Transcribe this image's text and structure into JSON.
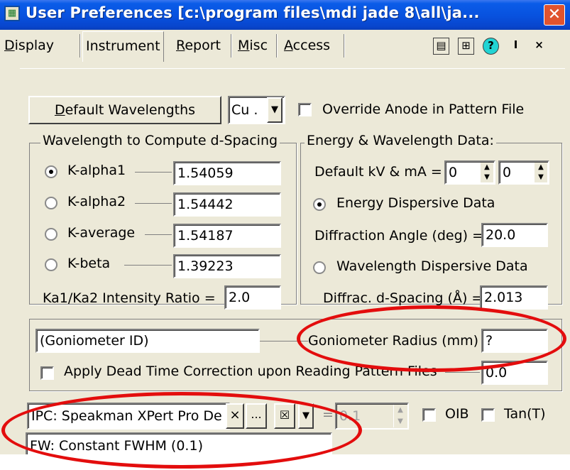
{
  "window": {
    "title": "User Preferences [c:\\program files\\mdi jade 8\\all\\ja...",
    "close_glyph": "✕",
    "icon_name": "app-icon"
  },
  "tabs": [
    {
      "label": "Display",
      "selected": false
    },
    {
      "label": "Instrument",
      "selected": true
    },
    {
      "label": "Report",
      "selected": false
    },
    {
      "label": "Misc",
      "selected": false
    },
    {
      "label": "Access",
      "selected": false
    }
  ],
  "toolbar": {
    "icons": [
      "layout-icon",
      "grid-icon",
      "help-icon",
      "pin-icon",
      "close-icon"
    ],
    "grid_glyph": "⊞",
    "help_glyph": "?",
    "pin_glyph": "I",
    "close_glyph": "×"
  },
  "top": {
    "default_wavelengths_label": "Default Wavelengths",
    "anode_value": "Cu .",
    "override_label": "Override Anode in Pattern File",
    "override_checked": false
  },
  "wavelength_group": {
    "title": "Wavelength to Compute d-Spacing",
    "options": [
      {
        "label": "K-alpha1",
        "value": "1.54059",
        "selected": true
      },
      {
        "label": "K-alpha2",
        "value": "1.54442",
        "selected": false
      },
      {
        "label": "K-average",
        "value": "1.54187",
        "selected": false
      },
      {
        "label": "K-beta",
        "value": "1.39223",
        "selected": false
      }
    ],
    "ratio_label": "Ka1/Ka2 Intensity Ratio =",
    "ratio_value": "2.0"
  },
  "energy_group": {
    "title": "Energy & Wavelength Data:",
    "kv_ma_label": "Default kV & mA =",
    "kv_value": "0",
    "ma_value": "0",
    "energy_label": "Energy Dispersive Data",
    "energy_selected": true,
    "angle_label": "Diffraction Angle (deg) =",
    "angle_value": "20.0",
    "wavelength_label": "Wavelength Dispersive Data",
    "wavelength_selected": false,
    "dspacing_label": "Diffrac. d-Spacing (Å) =",
    "dspacing_value": "2.013"
  },
  "goniometer": {
    "id_value": "(Goniometer ID)",
    "radius_label": "Goniometer Radius (mm) =",
    "radius_value": "?",
    "deadtime_label": "Apply Dead Time Correction upon Reading Pattern Files",
    "deadtime_checked": false,
    "deadtime_value": "0.0"
  },
  "ipc": {
    "combo_value": "IPC: Speakman XPert Pro De",
    "clear_glyph": "×",
    "browse_glyph": "...",
    "eq_label": "=",
    "spin_value": "0.1",
    "oib_label": "OIB",
    "tan_label": "Tan(T)",
    "fw_value": "FW: Constant FWHM (0.1)"
  },
  "colors": {
    "titlebar": "#0851de",
    "dialog": "#ece9d8",
    "close": "#e0532e",
    "annotation": "#e30d0d"
  }
}
